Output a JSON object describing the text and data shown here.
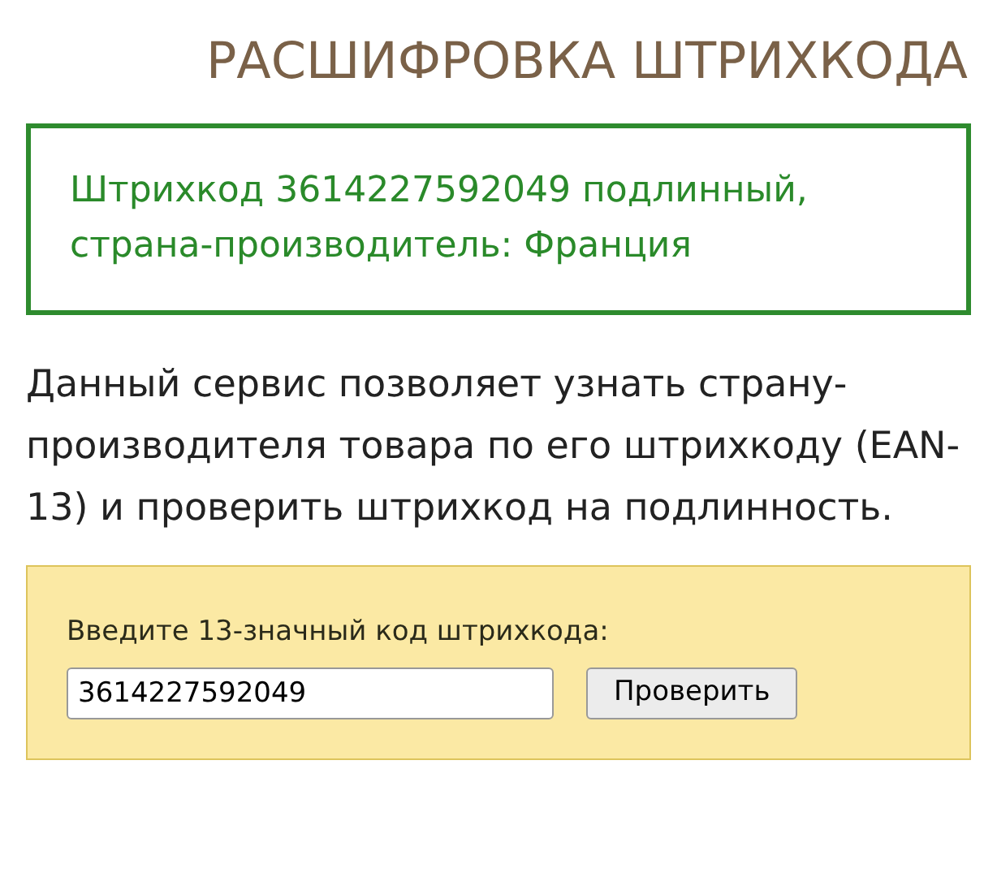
{
  "title": "РАСШИФРОВКА ШТРИХКОДА",
  "result": "Штрихкод 3614227592049 подлинный, страна-производитель: Франция",
  "description": "Данный сервис позволяет узнать страну-производителя товара по его штрихкоду (EAN-13) и проверить штрихкод на подлинность.",
  "form": {
    "label": "Введите 13-значный код штрихкода:",
    "value": "3614227592049",
    "button": "Проверить"
  }
}
